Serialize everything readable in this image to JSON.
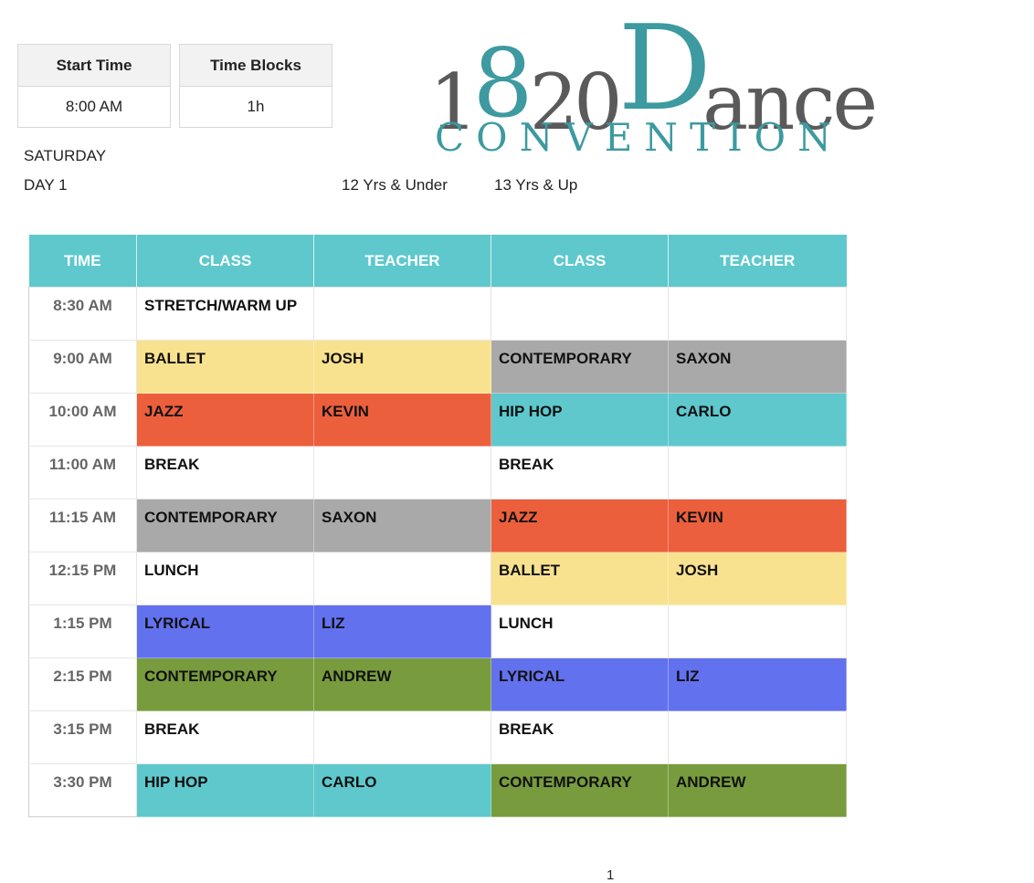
{
  "settings": {
    "start_time_label": "Start Time",
    "start_time_value": "8:00 AM",
    "time_blocks_label": "Time Blocks",
    "time_blocks_value": "1h"
  },
  "day": {
    "name": "SATURDAY",
    "label": "DAY 1"
  },
  "age_groups": [
    "12 Yrs & Under",
    "13 Yrs & Up"
  ],
  "logo": {
    "part1": "1",
    "part2": "8",
    "part3": "20",
    "part4": "D",
    "part5": "ance",
    "subtitle": "CONVENTION"
  },
  "colors": {
    "header": "#5ec8cd",
    "ballet": "#f9e28f",
    "jazz": "#ec5f3d",
    "contemporary_gray": "#a9a9a9",
    "hiphop": "#5ec8cd",
    "lyrical": "#6271ee",
    "contemporary_green": "#789c3d",
    "white": "#ffffff"
  },
  "table": {
    "headers": [
      "TIME",
      "CLASS",
      "TEACHER",
      "CLASS",
      "TEACHER"
    ],
    "rows": [
      {
        "time": "8:30 AM",
        "g1_class": "STRETCH/WARM UP",
        "g1_teacher": "",
        "g1_color": "white",
        "g2_class": "",
        "g2_teacher": "",
        "g2_color": "white"
      },
      {
        "time": "9:00 AM",
        "g1_class": "BALLET",
        "g1_teacher": "JOSH",
        "g1_color": "ballet",
        "g2_class": "CONTEMPORARY",
        "g2_teacher": "SAXON",
        "g2_color": "contemporary_gray"
      },
      {
        "time": "10:00 AM",
        "g1_class": "JAZZ",
        "g1_teacher": "KEVIN",
        "g1_color": "jazz",
        "g2_class": "HIP HOP",
        "g2_teacher": "CARLO",
        "g2_color": "hiphop"
      },
      {
        "time": "11:00 AM",
        "g1_class": "BREAK",
        "g1_teacher": "",
        "g1_color": "white",
        "g2_class": "BREAK",
        "g2_teacher": "",
        "g2_color": "white"
      },
      {
        "time": "11:15 AM",
        "g1_class": "CONTEMPORARY",
        "g1_teacher": "SAXON",
        "g1_color": "contemporary_gray",
        "g2_class": "JAZZ",
        "g2_teacher": "KEVIN",
        "g2_color": "jazz"
      },
      {
        "time": "12:15 PM",
        "g1_class": "LUNCH",
        "g1_teacher": "",
        "g1_color": "white",
        "g2_class": "BALLET",
        "g2_teacher": "JOSH",
        "g2_color": "ballet"
      },
      {
        "time": "1:15 PM",
        "g1_class": "LYRICAL",
        "g1_teacher": "LIZ",
        "g1_color": "lyrical",
        "g2_class": "LUNCH",
        "g2_teacher": "",
        "g2_color": "white"
      },
      {
        "time": "2:15 PM",
        "g1_class": "CONTEMPORARY",
        "g1_teacher": "ANDREW",
        "g1_color": "contemporary_green",
        "g2_class": "LYRICAL",
        "g2_teacher": "LIZ",
        "g2_color": "lyrical"
      },
      {
        "time": "3:15 PM",
        "g1_class": "BREAK",
        "g1_teacher": "",
        "g1_color": "white",
        "g2_class": "BREAK",
        "g2_teacher": "",
        "g2_color": "white"
      },
      {
        "time": "3:30 PM",
        "g1_class": "HIP HOP",
        "g1_teacher": "CARLO",
        "g1_color": "hiphop",
        "g2_class": "CONTEMPORARY",
        "g2_teacher": "ANDREW",
        "g2_color": "contemporary_green"
      }
    ]
  },
  "page_number": "1"
}
